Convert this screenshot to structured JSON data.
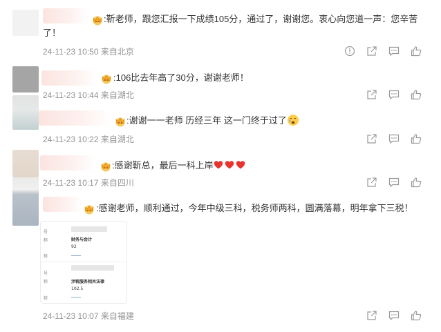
{
  "comments": [
    {
      "text": ":靳老师，跟您汇报一下成绩105分，通过了，谢谢您。衷心向您道一声：您辛苦了！",
      "line1": ":靳老师，跟您汇报一下成绩105分，通过了，谢谢您。衷心向您道一声：您辛苦",
      "line2": "了！",
      "meta": "24-11-23 10:50 来自北京",
      "actions": [
        "report-icon",
        "share-icon",
        "comment-icon",
        "like-icon"
      ]
    },
    {
      "text": ":106比去年高了30分，谢谢老师！",
      "meta": "24-11-23 10:44 来自湖北",
      "actions": [
        "share-icon",
        "comment-icon",
        "like-icon"
      ]
    },
    {
      "text": ":谢谢一一老师 历经三年 这一门终于过了",
      "meta": "24-11-23 10:22 来自湖北",
      "actions": [
        "share-icon",
        "comment-icon",
        "like-icon"
      ]
    },
    {
      "text": ":感谢靳总，最后一科上岸",
      "meta": "24-11-23 10:17 来自四川",
      "actions": [
        "share-icon",
        "comment-icon",
        "like-icon"
      ]
    },
    {
      "text": ":感谢老师，顺利通过，今年中级三科，税务师两科，圆满落幕，明年拿下三税！",
      "meta": "24-11-23 10:07 来自福建",
      "actions": [
        "share-icon",
        "comment-icon",
        "like-icon"
      ]
    }
  ],
  "attachment": {
    "labels": [
      "号",
      "称",
      "核",
      "号",
      "称",
      "核"
    ],
    "subject1": "财务与会计",
    "score1": "92",
    "subject2": "涉税服务相关法律",
    "score2": "102.5"
  },
  "colors": {
    "meta": "#939393",
    "heart": "#e8332f",
    "badge": "#f5a623",
    "icon": "#999999"
  }
}
